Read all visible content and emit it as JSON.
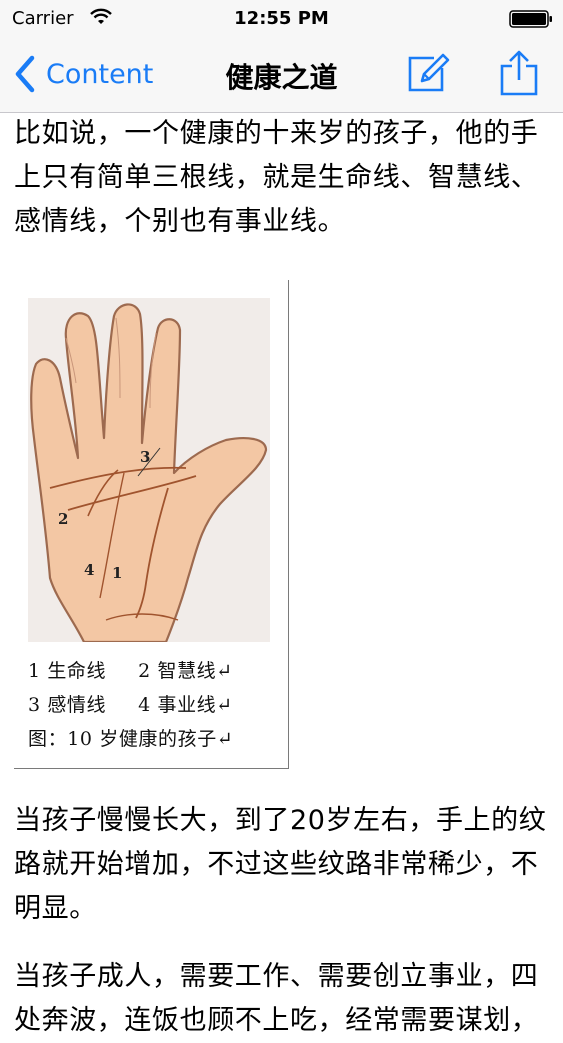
{
  "status_bar": {
    "carrier": "Carrier",
    "time": "12:55 PM"
  },
  "nav": {
    "back_label": "Content",
    "title": "健康之道",
    "accent_color": "#1a7cf6"
  },
  "content": {
    "paragraph_1": "比如说，一个健康的十来岁的孩子，他的手上只有简单三根线，就是生命线、智慧线、感情线，个别也有事业线。",
    "figure": {
      "labels": [
        "1",
        "2",
        "3",
        "4"
      ],
      "legend": [
        {
          "a": "1 生命线",
          "b": "2 智慧线↵"
        },
        {
          "a": "3 感情线",
          "b": "4 事业线↵"
        }
      ],
      "caption": "图：10 岁健康的孩子↵"
    },
    "paragraph_2": "当孩子慢慢长大，到了20岁左右，手上的纹路就开始增加，不过这些纹路非常稀少，不明显。",
    "paragraph_3": "当孩子成人，需要工作、需要创立事业，四处奔波，连饭也顾不上吃，经常需要谋划，"
  },
  "icons": [
    "wifi-icon",
    "battery-icon",
    "back-chevron-icon",
    "compose-icon",
    "share-icon"
  ]
}
